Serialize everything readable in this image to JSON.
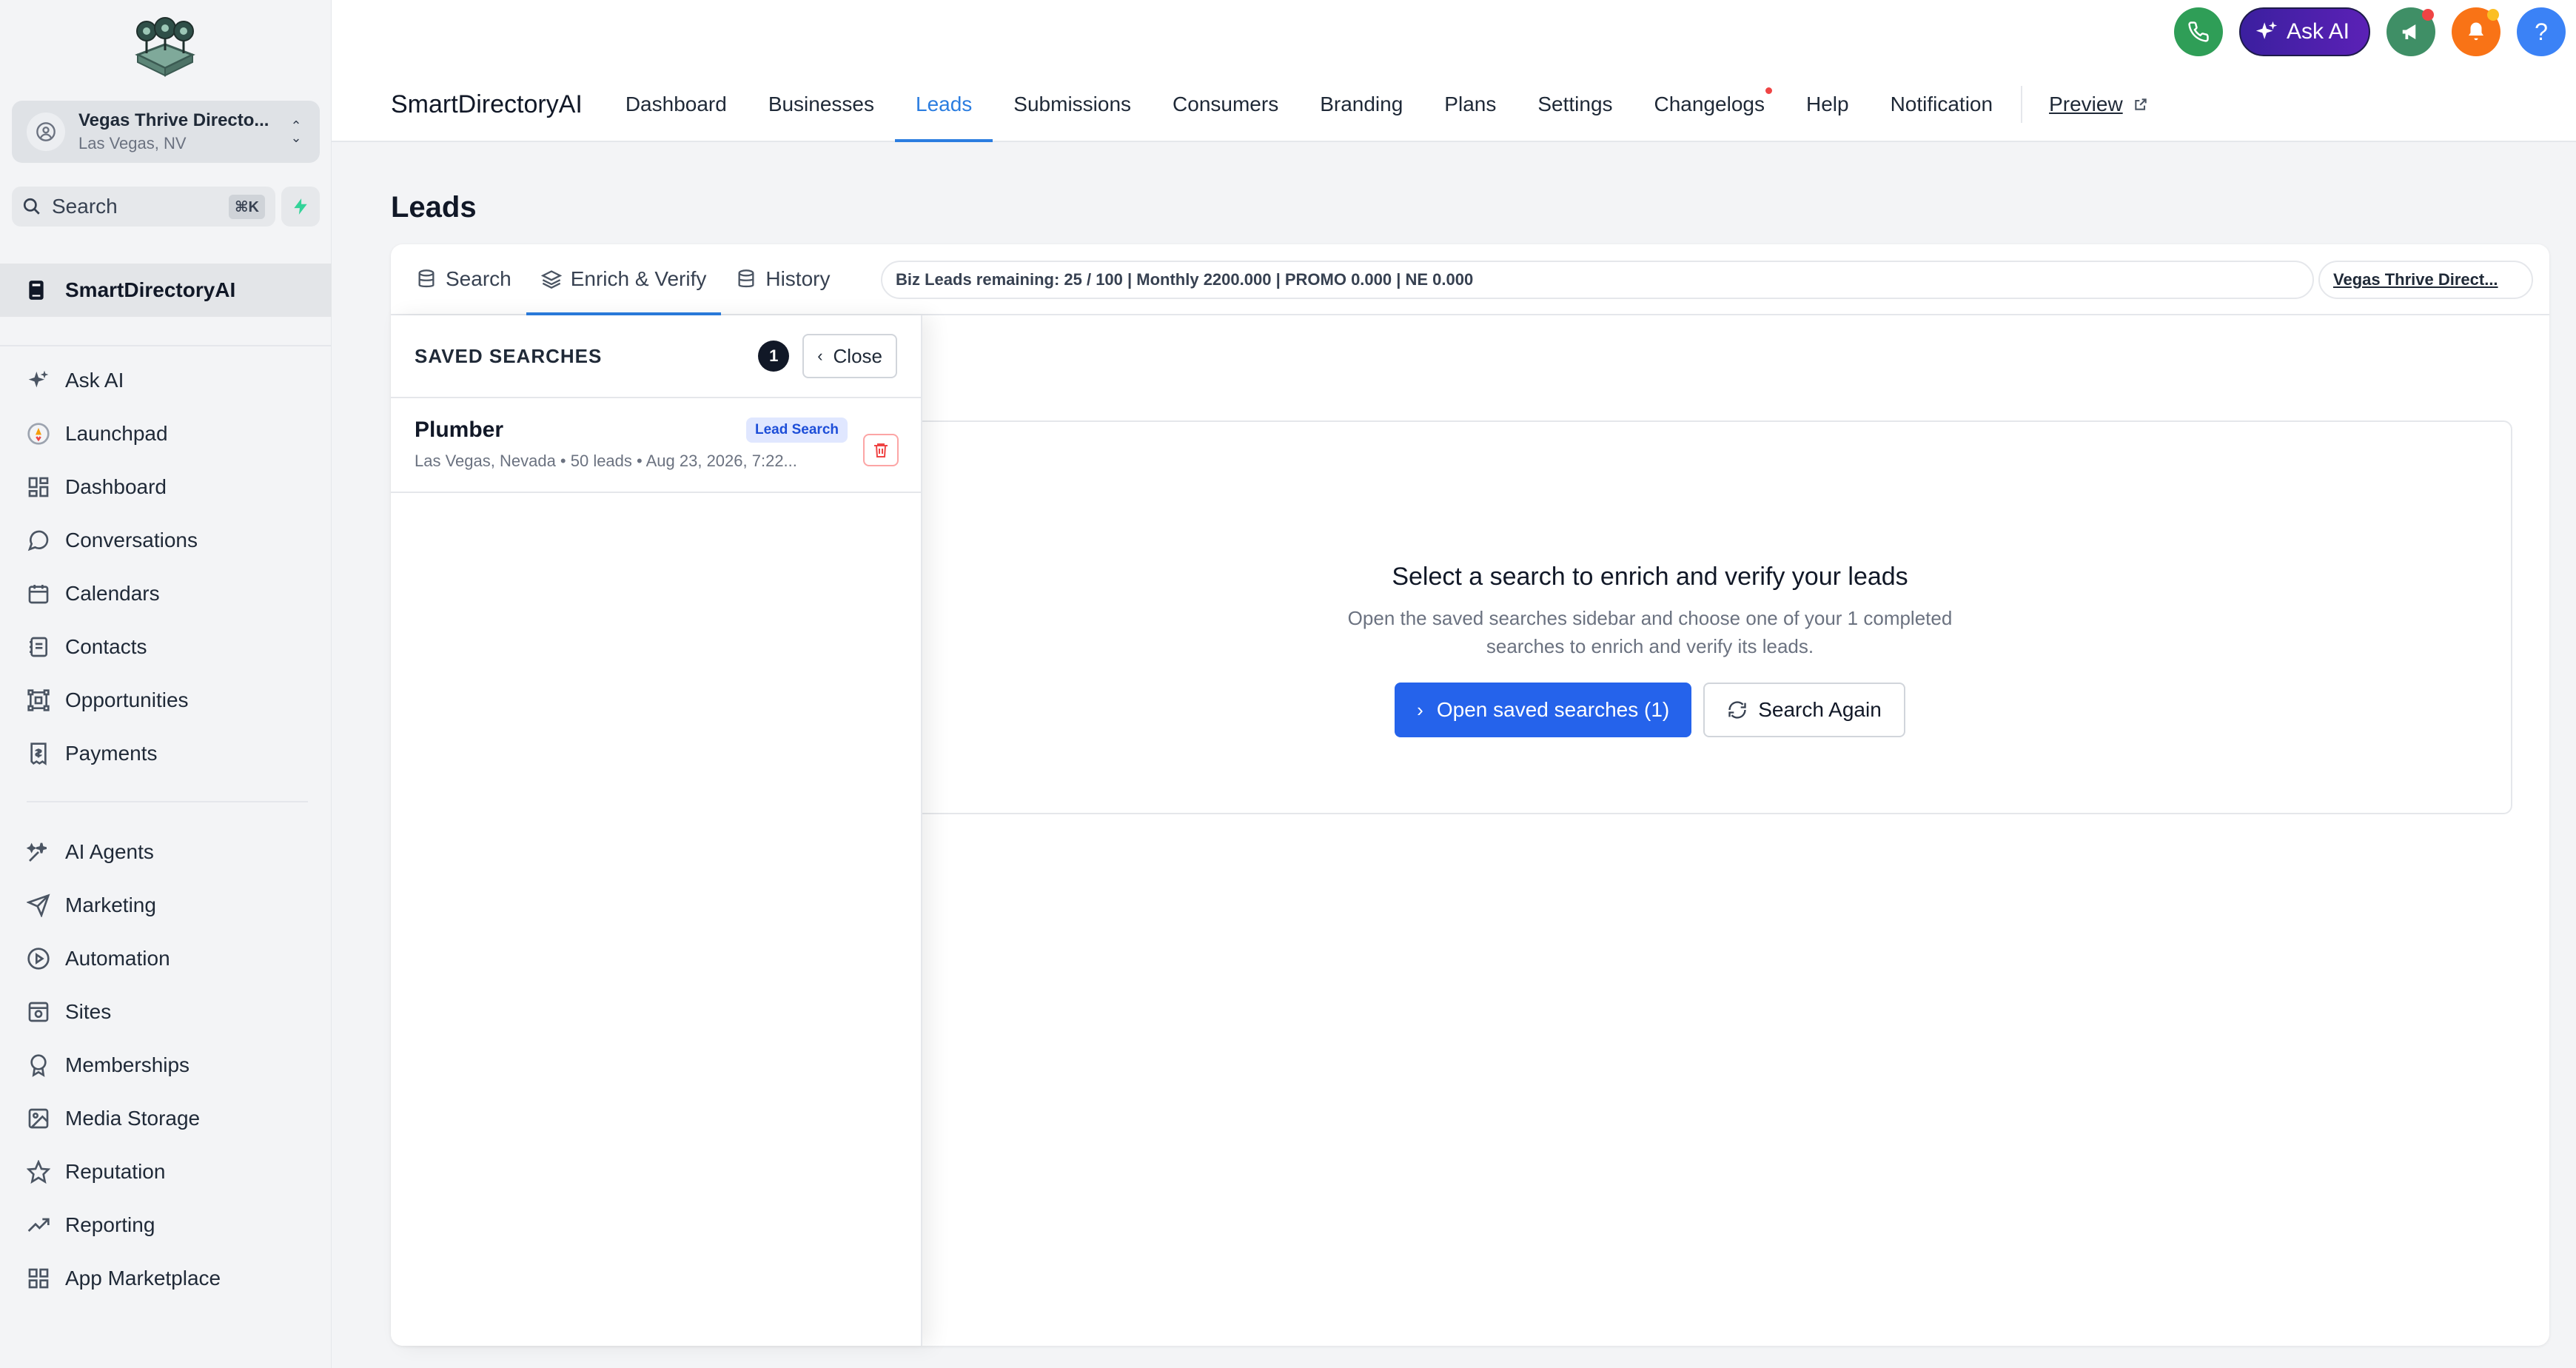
{
  "sidebar": {
    "account_name": "Vegas Thrive Directo...",
    "account_location": "Las Vegas, NV",
    "search_label": "Search",
    "search_shortcut": "⌘K",
    "active_item": "SmartDirectoryAI",
    "group1": [
      {
        "label": "Ask AI",
        "icon": "sparkle-icon"
      },
      {
        "label": "Launchpad",
        "icon": "rocket-icon"
      },
      {
        "label": "Dashboard",
        "icon": "grid-icon"
      },
      {
        "label": "Conversations",
        "icon": "chat-icon"
      },
      {
        "label": "Calendars",
        "icon": "calendar-icon"
      },
      {
        "label": "Contacts",
        "icon": "contacts-icon"
      },
      {
        "label": "Opportunities",
        "icon": "network-icon"
      },
      {
        "label": "Payments",
        "icon": "invoice-icon"
      }
    ],
    "group2": [
      {
        "label": "AI Agents",
        "icon": "ai-agent-icon"
      },
      {
        "label": "Marketing",
        "icon": "send-icon"
      },
      {
        "label": "Automation",
        "icon": "automation-icon"
      },
      {
        "label": "Sites",
        "icon": "site-icon"
      },
      {
        "label": "Memberships",
        "icon": "award-icon"
      },
      {
        "label": "Media Storage",
        "icon": "image-icon"
      },
      {
        "label": "Reputation",
        "icon": "star-icon"
      },
      {
        "label": "Reporting",
        "icon": "trend-icon"
      },
      {
        "label": "App Marketplace",
        "icon": "apps-icon"
      }
    ]
  },
  "topbar": {
    "ask_ai_label": "Ask AI",
    "help_label": "?",
    "colors": {
      "phone": "#2f9e57",
      "announce": "#3f8f66",
      "bell": "#f97316",
      "help": "#3b82f6"
    }
  },
  "appnav": {
    "brand": "SmartDirectoryAI",
    "tabs": [
      "Dashboard",
      "Businesses",
      "Leads",
      "Submissions",
      "Consumers",
      "Branding",
      "Plans",
      "Settings",
      "Changelogs",
      "Help",
      "Notification"
    ],
    "active_tab": "Leads",
    "preview_label": "Preview"
  },
  "page": {
    "title": "Leads",
    "subtabs": [
      {
        "label": "Search",
        "icon": "database-icon"
      },
      {
        "label": "Enrich & Verify",
        "icon": "layers-icon"
      },
      {
        "label": "History",
        "icon": "database-icon"
      }
    ],
    "active_subtab": "Enrich & Verify",
    "quota_text": "Biz Leads remaining: 25 / 100 | Monthly 2200.000 | PROMO 0.000 | NE 0.000",
    "account_pill": "Vegas Thrive Direct..."
  },
  "saved_searches": {
    "title": "SAVED SEARCHES",
    "count": "1",
    "close_label": "Close",
    "items": [
      {
        "name": "Plumber",
        "badge": "Lead Search",
        "meta": "Las Vegas, Nevada • 50 leads • Aug 23, 2026, 7:22..."
      }
    ]
  },
  "empty_state": {
    "title": "Select a search to enrich and verify your leads",
    "description": "Open the saved searches sidebar and choose one of your 1 completed searches to enrich and verify its leads.",
    "primary_button": "Open saved searches (1)",
    "secondary_button": "Search Again"
  },
  "colors": {
    "accent": "#2b7de0",
    "primary_button": "#2563eb",
    "danger": "#ef4444"
  }
}
